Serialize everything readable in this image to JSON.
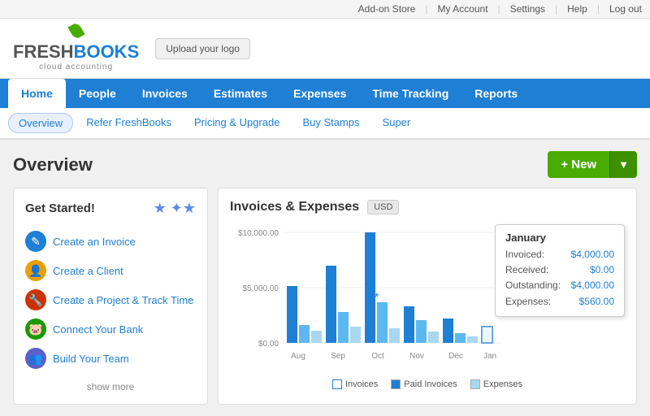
{
  "topbar": {
    "links": [
      "Add-on Store",
      "My Account",
      "Settings",
      "Help",
      "Log out"
    ]
  },
  "header": {
    "logo": {
      "fresh": "FRESH",
      "books": "BOOKS",
      "tagline": "cloud accounting"
    },
    "upload_logo": "Upload your logo"
  },
  "nav": {
    "items": [
      "Home",
      "People",
      "Invoices",
      "Estimates",
      "Expenses",
      "Time Tracking",
      "Reports"
    ],
    "active": "Home"
  },
  "subnav": {
    "items": [
      "Overview",
      "Refer FreshBooks",
      "Pricing & Upgrade",
      "Buy Stamps",
      "Super"
    ],
    "active": "Overview"
  },
  "page": {
    "title": "Overview"
  },
  "new_button": {
    "label": "+ New"
  },
  "get_started": {
    "title": "Get Started!",
    "links": [
      "Create an Invoice",
      "Create a Client",
      "Create a Project & Track Time",
      "Connect Your Bank",
      "Build Your Team"
    ],
    "show_more": "show more"
  },
  "chart": {
    "title": "Invoices & Expenses",
    "currency": "USD",
    "y_labels": [
      "$10,000.00",
      "$5,000.00",
      "$0.00"
    ],
    "months": [
      "Aug",
      "Sep",
      "Oct",
      "Nov",
      "Dec",
      "Jan"
    ],
    "bars": {
      "aug": {
        "invoiced": 70,
        "paid": 22,
        "expense": 15
      },
      "sep": {
        "invoiced": 95,
        "paid": 38,
        "expense": 20
      },
      "oct": {
        "invoiced": 135,
        "paid": 50,
        "expense": 18
      },
      "nov": {
        "invoiced": 45,
        "paid": 28,
        "expense": 14
      },
      "dec": {
        "invoiced": 30,
        "paid": 12,
        "expense": 10
      },
      "jan": {
        "invoiced": 20,
        "paid": 8,
        "expense": 6
      }
    },
    "tooltip": {
      "month": "January",
      "invoiced_label": "Invoiced:",
      "invoiced_value": "$4,000.00",
      "received_label": "Received:",
      "received_value": "$0.00",
      "outstanding_label": "Outstanding:",
      "outstanding_value": "$4,000.00",
      "expenses_label": "Expenses:",
      "expenses_value": "$560.00"
    },
    "legend": {
      "invoices": "Invoices",
      "paid": "Paid Invoices",
      "expenses": "Expenses"
    }
  }
}
